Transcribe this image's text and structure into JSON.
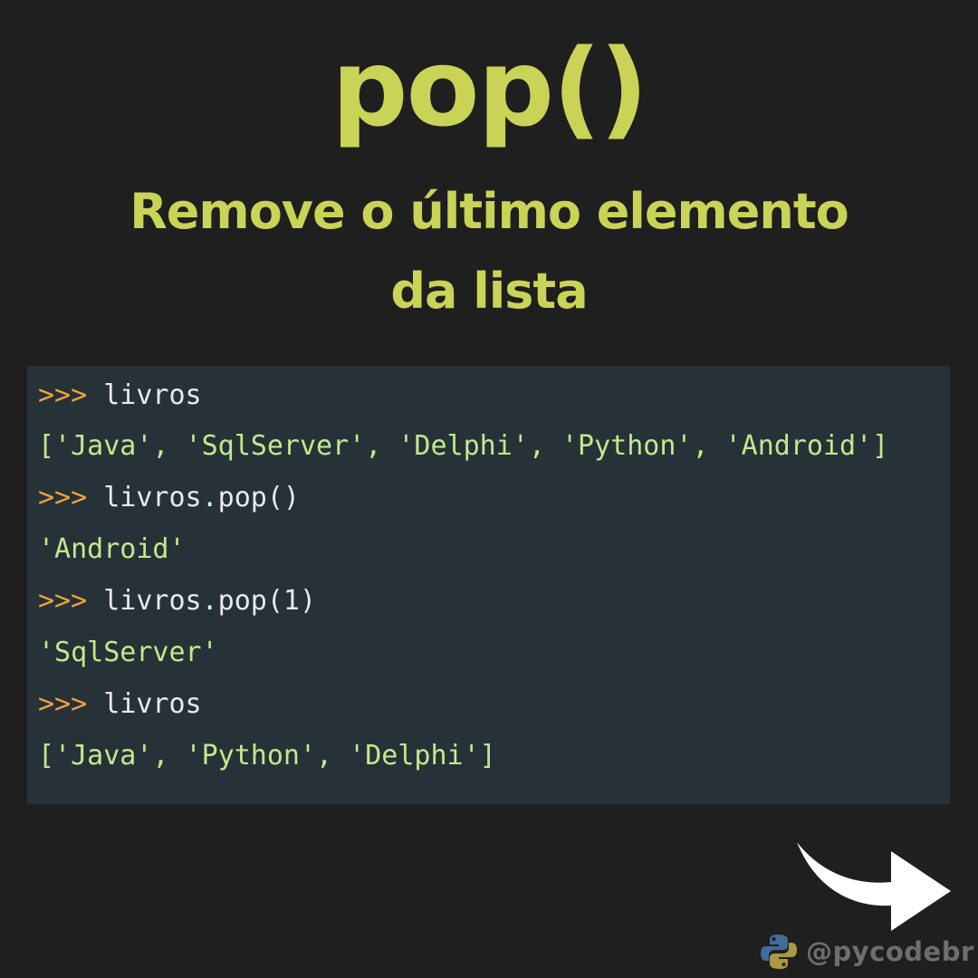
{
  "header": {
    "title": "pop()",
    "subtitle_line1": "Remove o último elemento",
    "subtitle_line2": "da lista"
  },
  "code": {
    "prompt": ">>>",
    "lines": [
      {
        "cmd": "livros"
      },
      {
        "out": "['Java', 'SqlServer', 'Delphi', 'Python', 'Android']"
      },
      {
        "cmd": "livros.pop()"
      },
      {
        "out": "'Android'"
      },
      {
        "cmd": "livros.pop(1)"
      },
      {
        "out": "'SqlServer'"
      },
      {
        "cmd": "livros"
      },
      {
        "out": "['Java', 'Python', 'Delphi']"
      }
    ]
  },
  "footer": {
    "handle": "@pycodebr",
    "next_icon": "curved-arrow-right-icon",
    "logo_icon": "python-logo-icon"
  },
  "colors": {
    "background": "#1f1f1f",
    "accent": "#c9d356",
    "code_background": "#263238",
    "prompt": "#f2a33a",
    "string": "#c3e88d",
    "number": "#c792ea"
  }
}
